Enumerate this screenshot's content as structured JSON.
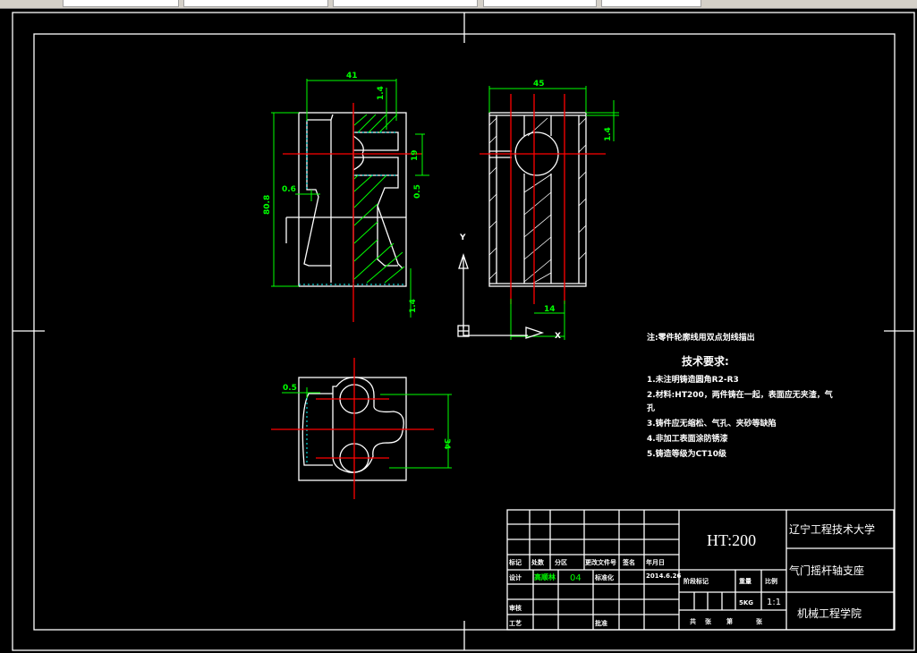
{
  "app": {
    "window": "CAD drawing viewport",
    "background": "#000000"
  },
  "colors": {
    "outline": "#ffffff",
    "center_line": "#ff0000",
    "dimension": "#00ff00",
    "hidden": "#00ffff"
  },
  "dimensions": {
    "front_width": "41",
    "front_height": "80.8",
    "front_top": "1.4",
    "front_slot": "19",
    "front_left": "0.6",
    "front_right": "0.5",
    "front_bottom": "1.4",
    "side_width": "45",
    "side_top": "1.4",
    "side_slot": "14",
    "top_left": "0.5",
    "top_height": "34"
  },
  "ucs": {
    "y_label": "Y",
    "x_label": "X"
  },
  "note": "注:零件轮廓线用双点划线描出",
  "tech": {
    "title": "技术要求:",
    "items": [
      "1.未注明铸造圆角R2-R3",
      "2.材料:HT200，两件铸在一起，表面应无夹渣，气",
      "孔",
      "3.铸件应无缩松、气孔、夹砂等缺陷",
      "4.非加工表面涂防锈漆",
      "5.铸造等级为CT10级"
    ]
  },
  "title_block": {
    "material": "HT:200",
    "school": "辽宁工程技术大学",
    "part_name": "气门摇杆轴支座",
    "college": "机械工程学院",
    "headers": [
      "标记",
      "处数",
      "分区",
      "更改文件号",
      "签名",
      "年月日"
    ],
    "design_label": "设计",
    "designer": "高顺林",
    "designer_no": "04",
    "standard_label": "标准化",
    "date": "2014.6.26",
    "review_label": "审核",
    "process_label": "工艺",
    "approve_label": "批准",
    "stage_label": "阶段标记",
    "weight_label": "重量",
    "scale_label": "比例",
    "weight": "5KG",
    "scale": "1:1",
    "sheets": [
      "共",
      "张",
      "第",
      "张"
    ]
  }
}
